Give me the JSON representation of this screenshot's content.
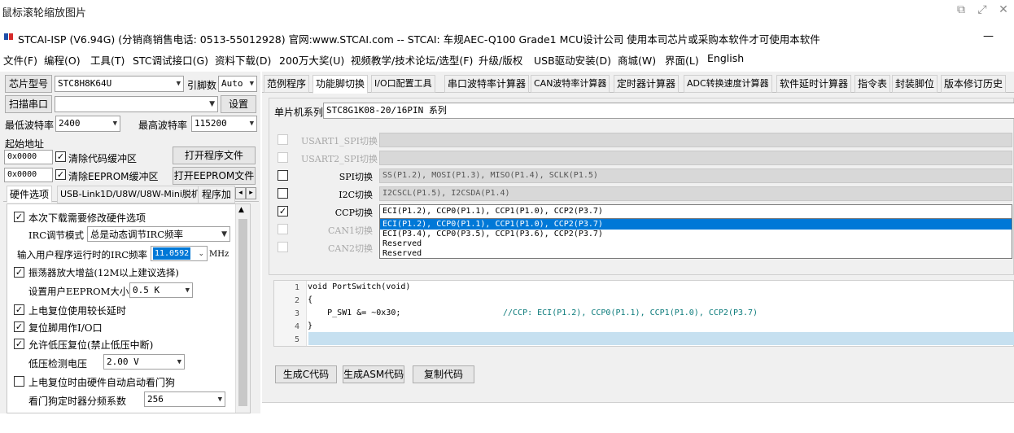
{
  "window": {
    "title": "鼠标滚轮缩放图片"
  },
  "app": {
    "title": "STCAI-ISP (V6.94G) (分销商销售电话: 0513-55012928) 官网:www.STCAI.com  -- STCAI: 车规AEC-Q100 Grade1 MCU设计公司 使用本司芯片或采购本软件才可使用本软件",
    "minimize": "—"
  },
  "menu": [
    "文件(F)",
    "编程(O)",
    "工具(T)",
    "STC调试接口(G)",
    "资料下载(D)",
    "200万大奖(U)",
    "视频教学/技术论坛/选型(F)",
    "升级/版权",
    "USB驱动安装(D)",
    "商城(W)",
    "界面(L)",
    "English"
  ],
  "left": {
    "chip_btn": "芯片型号",
    "chip_value": "STC8H8K64U",
    "pin_label": "引脚数",
    "pin_value": "Auto",
    "scan_btn": "扫描串口",
    "port_value": "",
    "settings_btn": "设置",
    "min_baud_label": "最低波特率",
    "min_baud_value": "2400",
    "max_baud_label": "最高波特率",
    "max_baud_value": "115200",
    "start_addr_label": "起始地址",
    "addr1": "0x0000",
    "clear_code_label": "清除代码缓冲区",
    "open_prog_btn": "打开程序文件",
    "addr2": "0x0000",
    "clear_eeprom_label": "清除EEPROM缓冲区",
    "open_eeprom_btn": "打开EEPROM文件",
    "tabs": [
      "硬件选项",
      "USB-Link1D/U8W/U8W-Mini脱机",
      "程序加"
    ],
    "hw": {
      "opt1": "本次下载需要修改硬件选项",
      "irc_mode_label": "IRC调节模式",
      "irc_mode_value": "总是动态调节IRC频率",
      "irc_freq_label": "输入用户程序运行时的IRC频率",
      "irc_freq_value": "11.0592",
      "irc_freq_unit": "MHz",
      "opt2": "振荡器放大增益(12M以上建议选择)",
      "eeprom_size_label": "设置用户EEPROM大小",
      "eeprom_size_value": "0.5 K",
      "opt3": "上电复位使用较长延时",
      "opt4": "复位脚用作I/O口",
      "opt5": "允许低压复位(禁止低压中断)",
      "lv_label": "低压检测电压",
      "lv_value": "2.00 V",
      "opt6": "上电复位时由硬件自动启动看门狗",
      "wdt_label": "看门狗定时器分频系数",
      "wdt_value": "256"
    }
  },
  "right": {
    "tabs": [
      "范例程序",
      "功能脚切换",
      "I/O口配置工具",
      "串口波特率计算器",
      "CAN波特率计算器",
      "定时器计算器",
      "ADC转换速度计算器",
      "软件延时计算器",
      "指令表",
      "封装脚位",
      "版本修订历史"
    ],
    "series_label": "单片机系列",
    "series_value": "STC8G1K08-20/16PIN 系列",
    "switches": [
      {
        "label": "USART1_SPI切换",
        "value": "",
        "enabled": false,
        "checked": false
      },
      {
        "label": "USART2_SPI切换",
        "value": "",
        "enabled": false,
        "checked": false
      },
      {
        "label": "SPI切换",
        "value": "SS(P1.2), MOSI(P1.3), MISO(P1.4), SCLK(P1.5)",
        "enabled": true,
        "checked": false
      },
      {
        "label": "I2C切换",
        "value": "I2CSCL(P1.5), I2CSDA(P1.4)",
        "enabled": true,
        "checked": false
      },
      {
        "label": "CCP切换",
        "value": "ECI(P1.2), CCP0(P1.1), CCP1(P1.0), CCP2(P3.7)",
        "enabled": true,
        "checked": true
      },
      {
        "label": "CAN1切换",
        "value": "",
        "enabled": false,
        "checked": false
      },
      {
        "label": "CAN2切换",
        "value": "",
        "enabled": false,
        "checked": false
      }
    ],
    "ccp_options": [
      "ECI(P1.2), CCP0(P1.1), CCP1(P1.0), CCP2(P3.7)",
      "ECI(P3.4), CCP0(P3.5), CCP1(P3.6), CCP2(P3.7)",
      "Reserved",
      "Reserved"
    ],
    "code": {
      "line_numbers": [
        "1",
        "2",
        "3",
        "4",
        "5"
      ],
      "lines": [
        "void PortSwitch(void)",
        "{",
        "    P_SW1 &= ~0x30;",
        "}",
        ""
      ],
      "comment": "//CCP: ECI(P1.2), CCP0(P1.1), CCP1(P1.0), CCP2(P3.7)"
    },
    "btn_c": "生成C代码",
    "btn_asm": "生成ASM代码",
    "btn_copy": "复制代码"
  },
  "colors": {
    "selection": "#0078d7",
    "highlight_line": "#c6e0f0",
    "comment": "#0a7a7a"
  }
}
